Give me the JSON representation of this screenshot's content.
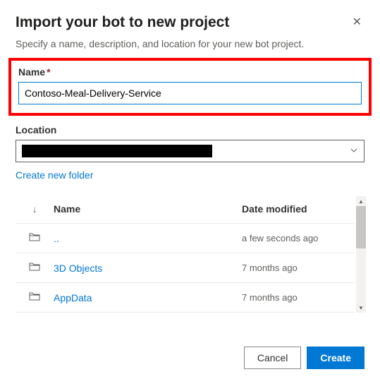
{
  "dialog": {
    "title": "Import your bot to new project",
    "subtitle": "Specify a name, description, and location for your new bot project."
  },
  "name_field": {
    "label": "Name",
    "required_mark": "*",
    "value": "Contoso-Meal-Delivery-Service"
  },
  "location_field": {
    "label": "Location",
    "value_redacted": true,
    "create_link": "Create new folder"
  },
  "table": {
    "headers": {
      "name": "Name",
      "modified": "Date modified"
    },
    "rows": [
      {
        "name": "..",
        "modified": "a few seconds ago",
        "is_parent": true
      },
      {
        "name": "3D Objects",
        "modified": "7 months ago",
        "is_parent": false
      },
      {
        "name": "AppData",
        "modified": "7 months ago",
        "is_parent": false
      }
    ]
  },
  "footer": {
    "cancel": "Cancel",
    "create": "Create"
  }
}
